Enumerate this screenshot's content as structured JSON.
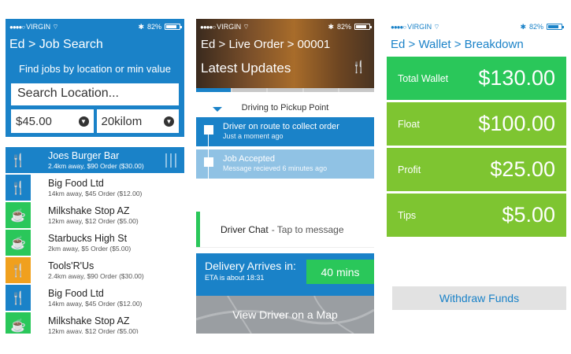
{
  "status_bar": {
    "carrier": "VIRGIN",
    "signal": "●●●●○",
    "time": "",
    "battery": "82%"
  },
  "job_search": {
    "breadcrumb": "Ed > Job Search",
    "hint": "Find jobs by location or min value",
    "search_placeholder": "Search Location...",
    "filter_value": "$45.00",
    "filter_distance": "20kilom",
    "jobs": [
      {
        "name": "Joes Burger Bar",
        "meta": "2.4km away, $90 Order ($30.00)",
        "icon": "fork-knife-icon",
        "color": "blue",
        "selected": true
      },
      {
        "name": "Big Food Ltd",
        "meta": "14km away, $45 Order ($12.00)",
        "icon": "fork-knife-icon",
        "color": "blue"
      },
      {
        "name": "Milkshake Stop AZ",
        "meta": "12km away, $12 Order ($5.00)",
        "icon": "cup-icon",
        "color": "green"
      },
      {
        "name": "Starbucks High St",
        "meta": "2km away, $5 Order ($5.00)",
        "icon": "cup-icon",
        "color": "green"
      },
      {
        "name": "Tools'R'Us",
        "meta": "2.4km away, $90 Order ($30.00)",
        "icon": "fork-knife-icon",
        "color": "orange"
      },
      {
        "name": "Big Food Ltd",
        "meta": "14km away, $45 Order ($12.00)",
        "icon": "fork-knife-icon",
        "color": "blue"
      },
      {
        "name": "Milkshake Stop AZ",
        "meta": "12km away, $12 Order ($5.00)",
        "icon": "cup-icon",
        "color": "green"
      }
    ]
  },
  "live_order": {
    "breadcrumb": "Ed > Live Order > 00001",
    "heading": "Latest Updates",
    "stage": "Driving to Pickup Point",
    "updates": [
      {
        "title": "Driver on route to collect order",
        "time": "Just a moment ago"
      },
      {
        "title": "Job Accepted",
        "time": "Message recieved 6 minutes ago"
      }
    ],
    "chat_label": "Driver Chat",
    "chat_hint": "- Tap to message",
    "arrive_title": "Delivery Arrives in:",
    "arrive_eta": "ETA is about 18:31",
    "arrive_mins": "40 mins",
    "map_button": "View Driver on a Map"
  },
  "wallet": {
    "breadcrumb": "Ed >  Wallet > Breakdown",
    "rows": [
      {
        "label": "Total Wallet",
        "amount": "$130.00"
      },
      {
        "label": "Float",
        "amount": "$100.00"
      },
      {
        "label": "Profit",
        "amount": "$25.00"
      },
      {
        "label": "Tips",
        "amount": "$5.00"
      }
    ],
    "withdraw_button": "Withdraw Funds"
  },
  "colors": {
    "blue": "#1a82c8",
    "green": "#2ac75a",
    "lime": "#7ec531",
    "orange": "#f0a01e"
  }
}
